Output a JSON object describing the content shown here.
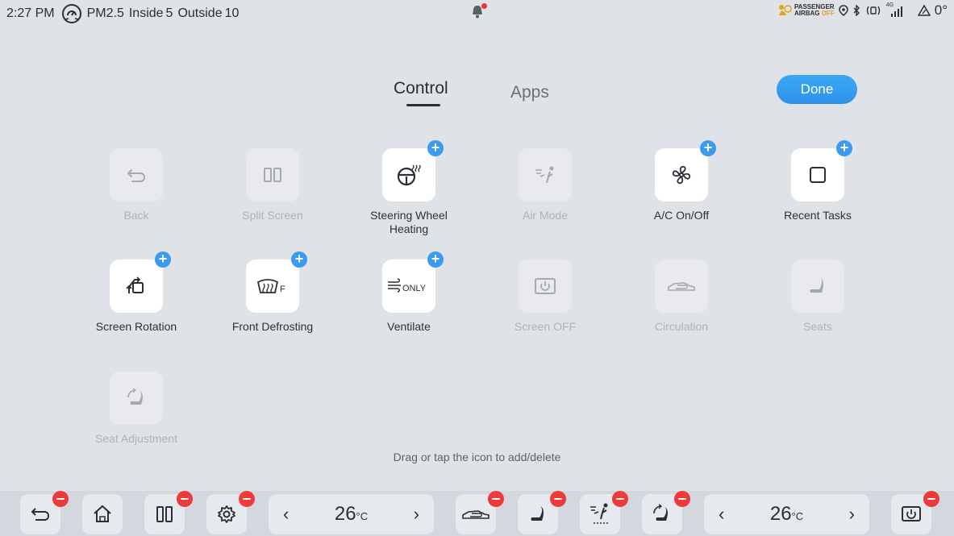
{
  "status": {
    "time": "2:27 PM",
    "pm_label": "PM2.5",
    "inside_label": "Inside",
    "inside_value": "5",
    "outside_label": "Outside",
    "outside_value": "10",
    "airbag_line1": "PASSENGER",
    "airbag_line2": "AIRBAG",
    "airbag_state": "OFF",
    "network": "4G",
    "outside_temp": "0°"
  },
  "tabs": {
    "control": "Control",
    "apps": "Apps"
  },
  "done_label": "Done",
  "tiles": [
    {
      "label": "Back",
      "enabled": false,
      "icon": "back-icon"
    },
    {
      "label": "Split Screen",
      "enabled": false,
      "icon": "split-screen-icon"
    },
    {
      "label": "Steering Wheel Heating",
      "enabled": true,
      "icon": "steering-wheel-heat-icon"
    },
    {
      "label": "Air Mode",
      "enabled": false,
      "icon": "air-mode-icon"
    },
    {
      "label": "A/C On/Off",
      "enabled": true,
      "icon": "fan-icon"
    },
    {
      "label": "Recent Tasks",
      "enabled": true,
      "icon": "recent-tasks-icon"
    },
    {
      "label": "Screen Rotation",
      "enabled": true,
      "icon": "screen-rotation-icon"
    },
    {
      "label": "Front Defrosting",
      "enabled": true,
      "icon": "front-defrost-icon"
    },
    {
      "label": "Ventilate",
      "enabled": true,
      "icon": "ventilate-icon"
    },
    {
      "label": "Screen OFF",
      "enabled": false,
      "icon": "screen-off-icon"
    },
    {
      "label": "Circulation",
      "enabled": false,
      "icon": "circulation-icon"
    },
    {
      "label": "Seats",
      "enabled": false,
      "icon": "seat-icon"
    },
    {
      "label": "Seat Adjustment",
      "enabled": false,
      "icon": "seat-adjust-icon"
    }
  ],
  "defrost_letter": "F",
  "ventilate_text": "ONLY",
  "hint": "Drag or tap the icon to add/delete",
  "dock": {
    "left_temp": "26",
    "right_temp": "26",
    "temp_unit": "°C",
    "arrow_left": "‹",
    "arrow_right": "›"
  }
}
